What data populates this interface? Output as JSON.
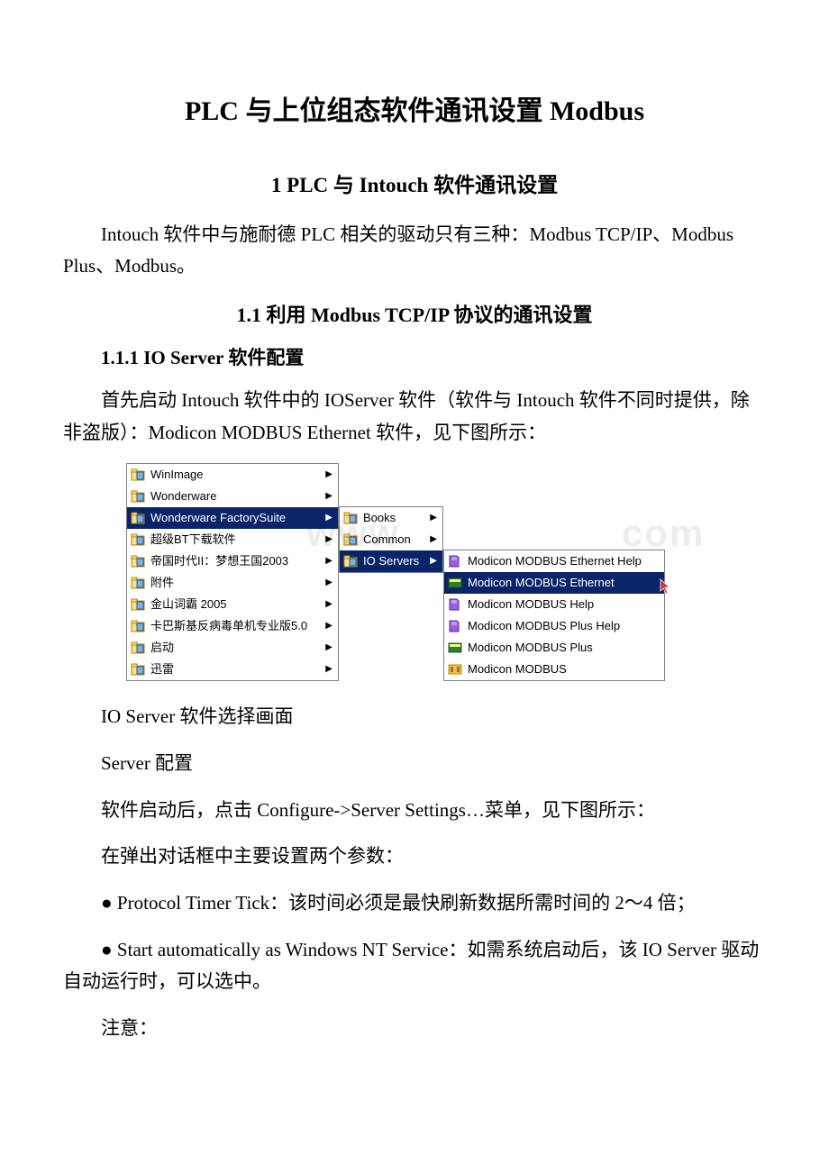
{
  "title": "PLC 与上位组态软件通讯设置 Modbus",
  "sec1": "1 PLC 与 Intouch 软件通讯设置",
  "p1": "Intouch 软件中与施耐德 PLC 相关的驱动只有三种：Modbus TCP/IP、Modbus Plus、Modbus。",
  "sec11": "1.1 利用 Modbus TCP/IP 协议的通讯设置",
  "sec111": "1.1.1 IO Server 软件配置",
  "p2": "首先启动 Intouch 软件中的 IOServer 软件（软件与 Intouch 软件不同时提供，除非盗版）：Modicon MODBUS Ethernet 软件，见下图所示：",
  "menu": {
    "col1": [
      "WinImage",
      "Wonderware",
      "Wonderware FactorySuite",
      "超级BT下载软件",
      "帝国时代II：梦想王国2003",
      "附件",
      "金山词霸 2005",
      "卡巴斯基反病毒单机专业版5.0",
      "启动",
      "迅雷"
    ],
    "col2": [
      "Books",
      "Common",
      "IO Servers"
    ],
    "col3": [
      "Modicon MODBUS Ethernet Help",
      "Modicon MODBUS Ethernet",
      "Modicon MODBUS Help",
      "Modicon MODBUS Plus Help",
      "Modicon MODBUS Plus",
      "Modicon MODBUS"
    ]
  },
  "cap1": "IO Server 软件选择画面",
  "cap2": "Server 配置",
  "p3": "软件启动后，点击 Configure->Server Settings…菜单，见下图所示：",
  "p4": "在弹出对话框中主要设置两个参数：",
  "p5": "● Protocol Timer Tick：该时间必须是最快刷新数据所需时间的 2～4 倍；",
  "p6": "● Start automatically as Windows NT Service：如需系统启动后，该 IO Server 驱动自动运行时，可以选中。",
  "p7": "注意："
}
